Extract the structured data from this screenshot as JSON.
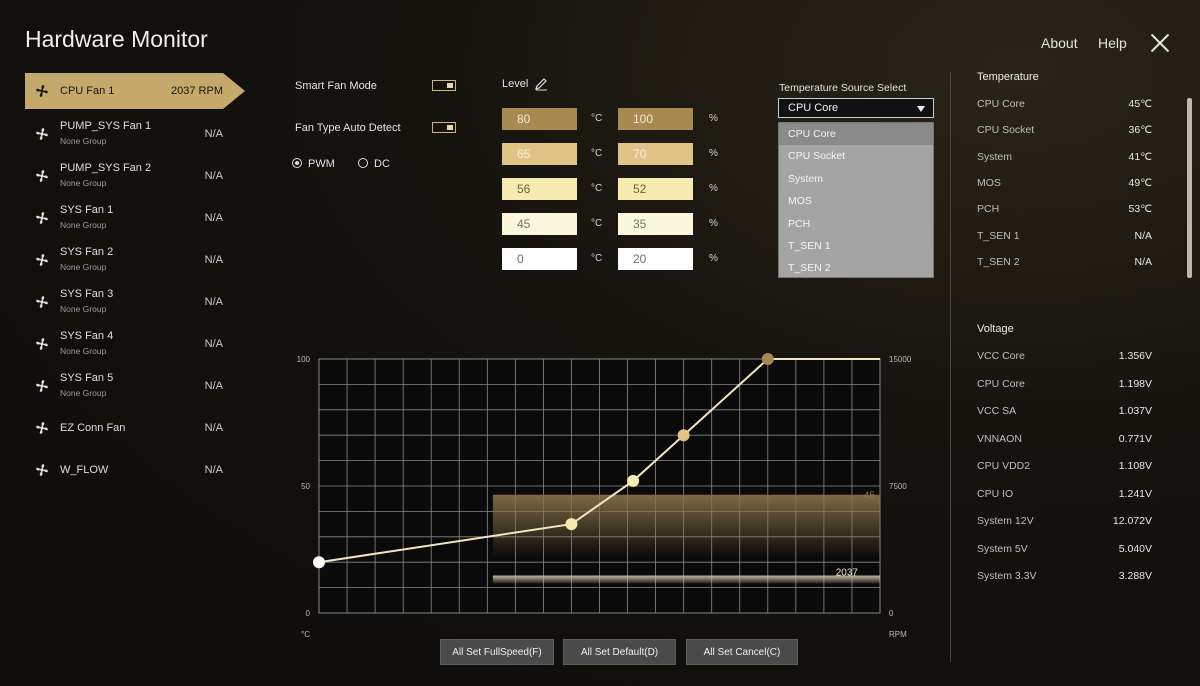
{
  "app": {
    "title": "Hardware Monitor",
    "about": "About",
    "help": "Help"
  },
  "fans": [
    {
      "name": "CPU Fan 1",
      "group": "",
      "value": "2037 RPM"
    },
    {
      "name": "PUMP_SYS Fan 1",
      "group": "None Group",
      "value": "N/A"
    },
    {
      "name": "PUMP_SYS Fan 2",
      "group": "None Group",
      "value": "N/A"
    },
    {
      "name": "SYS Fan 1",
      "group": "None Group",
      "value": "N/A"
    },
    {
      "name": "SYS Fan 2",
      "group": "None Group",
      "value": "N/A"
    },
    {
      "name": "SYS Fan 3",
      "group": "None Group",
      "value": "N/A"
    },
    {
      "name": "SYS Fan 4",
      "group": "None Group",
      "value": "N/A"
    },
    {
      "name": "SYS Fan 5",
      "group": "None Group",
      "value": "N/A"
    },
    {
      "name": "EZ Conn Fan",
      "group": "",
      "value": "N/A"
    },
    {
      "name": "W_FLOW",
      "group": "",
      "value": "N/A"
    }
  ],
  "controls": {
    "smart_fan_mode": "Smart Fan Mode",
    "fan_type_auto": "Fan Type Auto Detect",
    "pwm": "PWM",
    "dc": "DC",
    "level": "Level",
    "temp_unit": "°C",
    "pct_unit": "%"
  },
  "levels": [
    {
      "temp": "80",
      "pct": "100",
      "color": "#a8894f",
      "text": "#f4ead2"
    },
    {
      "temp": "65",
      "pct": "70",
      "color": "#e1c387",
      "text": "#f8efd9"
    },
    {
      "temp": "56",
      "pct": "52",
      "color": "#f6ecb2",
      "text": "#6a5f3b"
    },
    {
      "temp": "45",
      "pct": "35",
      "color": "#fbf7dc",
      "text": "#7b7566"
    },
    {
      "temp": "0",
      "pct": "20",
      "color": "#ffffff",
      "text": "#6f6f6f"
    }
  ],
  "temp_source": {
    "label": "Temperature Source Select",
    "selected": "CPU Core",
    "options": [
      "CPU Core",
      "CPU Socket",
      "System",
      "MOS",
      "PCH",
      "T_SEN 1",
      "T_SEN 2"
    ]
  },
  "temperature": {
    "heading": "Temperature",
    "items": [
      {
        "name": "CPU Core",
        "value": "45℃"
      },
      {
        "name": "CPU Socket",
        "value": "36℃"
      },
      {
        "name": "System",
        "value": "41℃"
      },
      {
        "name": "MOS",
        "value": "49℃"
      },
      {
        "name": "PCH",
        "value": "53℃"
      },
      {
        "name": "T_SEN 1",
        "value": "N/A"
      },
      {
        "name": "T_SEN 2",
        "value": "N/A"
      }
    ]
  },
  "voltage": {
    "heading": "Voltage",
    "items": [
      {
        "name": "VCC Core",
        "value": "1.356V"
      },
      {
        "name": "CPU Core",
        "value": "1.198V"
      },
      {
        "name": "VCC SA",
        "value": "1.037V"
      },
      {
        "name": "VNNAON",
        "value": "0.771V"
      },
      {
        "name": "CPU VDD2",
        "value": "1.108V"
      },
      {
        "name": "CPU IO",
        "value": "1.241V"
      },
      {
        "name": "System 12V",
        "value": "12.072V"
      },
      {
        "name": "System 5V",
        "value": "5.040V"
      },
      {
        "name": "System 3.3V",
        "value": "3.288V"
      }
    ]
  },
  "chart": {
    "left_ticks": [
      "100",
      "50",
      "0"
    ],
    "right_ticks": [
      "15000",
      "7500",
      "0"
    ],
    "left_unit": "°C",
    "right_unit": "RPM",
    "temp_trace_label": "45",
    "rpm_trace_label": "2037"
  },
  "chart_data": {
    "type": "line",
    "curve_points": [
      {
        "temp": 0,
        "pct": 20
      },
      {
        "temp": 45,
        "pct": 35
      },
      {
        "temp": 56,
        "pct": 52
      },
      {
        "temp": 65,
        "pct": 70
      },
      {
        "temp": 80,
        "pct": 100
      },
      {
        "temp": 100,
        "pct": 100
      }
    ],
    "x_range": [
      0,
      100
    ],
    "y_range": [
      0,
      100
    ],
    "rpm_range": [
      0,
      15000
    ],
    "current_temp": 45,
    "current_rpm": 2037,
    "grid": true
  },
  "buttons": {
    "full_speed": "All Set FullSpeed(F)",
    "default": "All Set Default(D)",
    "cancel": "All Set Cancel(C)"
  }
}
